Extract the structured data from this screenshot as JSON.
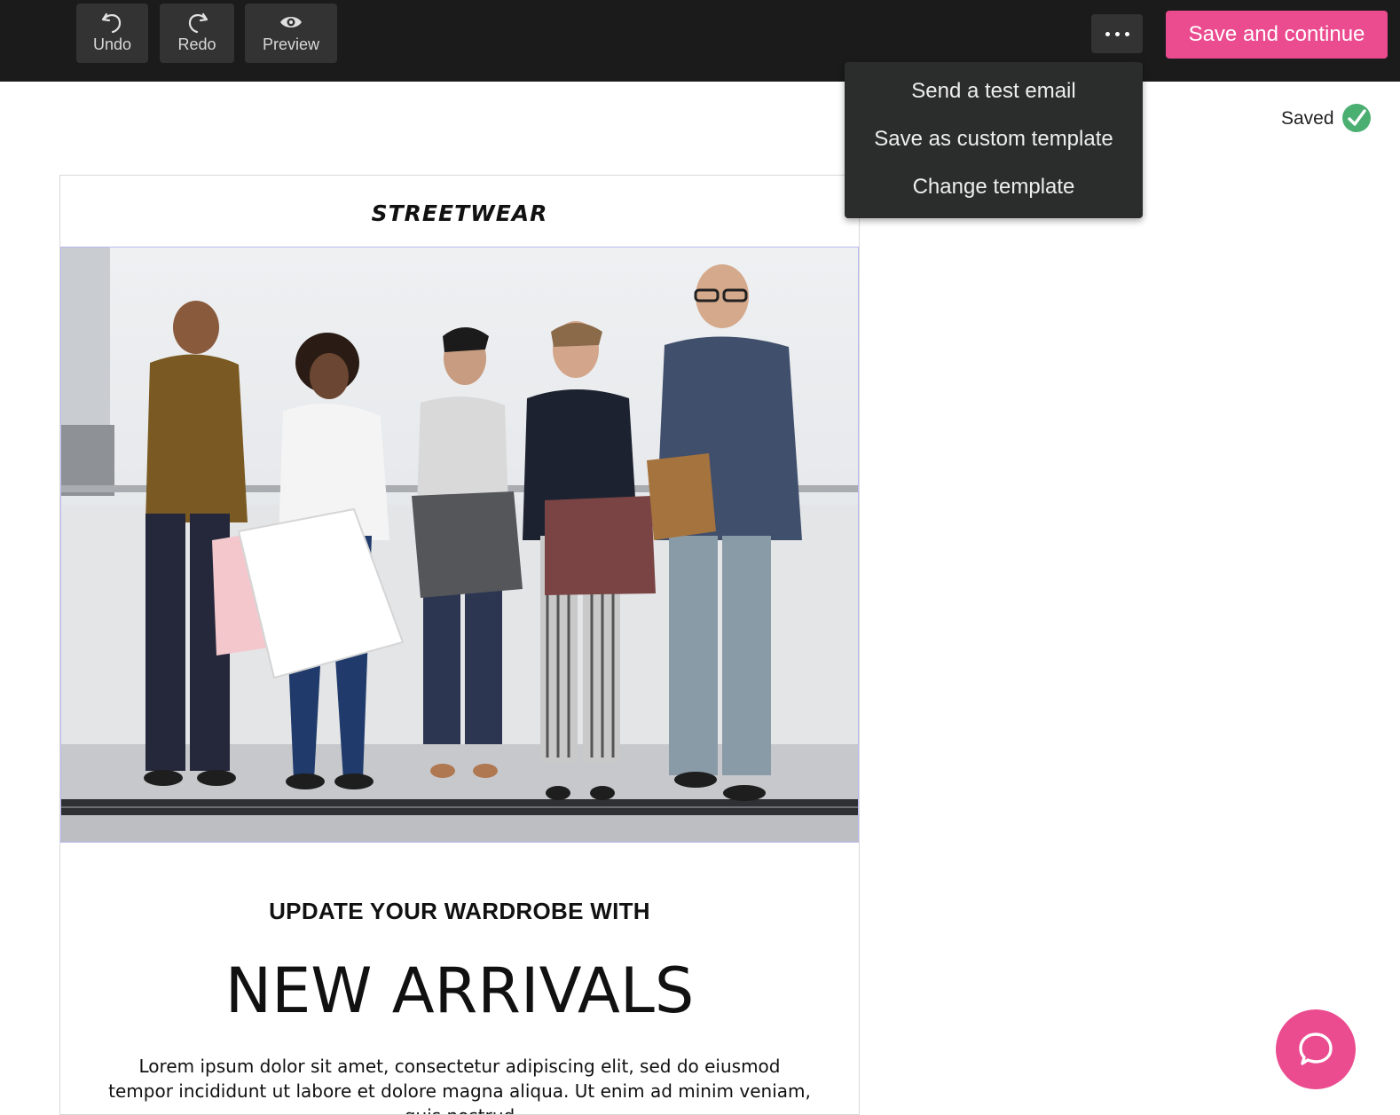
{
  "toolbar": {
    "undo_label": "Undo",
    "undo_icon": "undo-icon",
    "redo_label": "Redo",
    "redo_icon": "redo-icon",
    "preview_label": "Preview",
    "preview_icon": "eye-icon",
    "more_icon": "more-dots-icon",
    "save_label": "Save and continue"
  },
  "menu": {
    "items": [
      {
        "label": "Send a test email"
      },
      {
        "label": "Save as custom template"
      },
      {
        "label": "Change template"
      }
    ]
  },
  "status": {
    "saved_label": "Saved",
    "saved_icon": "check-circle-icon"
  },
  "email": {
    "brand": "STREETWEAR",
    "hero_image": "people-with-shopping-bags",
    "headline_small": "UPDATE YOUR WARDROBE WITH",
    "headline_large": "NEW ARRIVALS",
    "body": "Lorem ipsum dolor sit amet, consectetur adipiscing elit, sed do eiusmod tempor incididunt ut labore et dolore magna aliqua. Ut enim ad minim veniam, quis nostrud"
  },
  "chat": {
    "icon": "chat-bubble-icon"
  },
  "colors": {
    "accent": "#eb4b8f",
    "toolbar_bg": "#1b1b1b",
    "button_bg": "#333333",
    "menu_bg": "#2b2c2c",
    "saved_check": "#4caf72"
  }
}
